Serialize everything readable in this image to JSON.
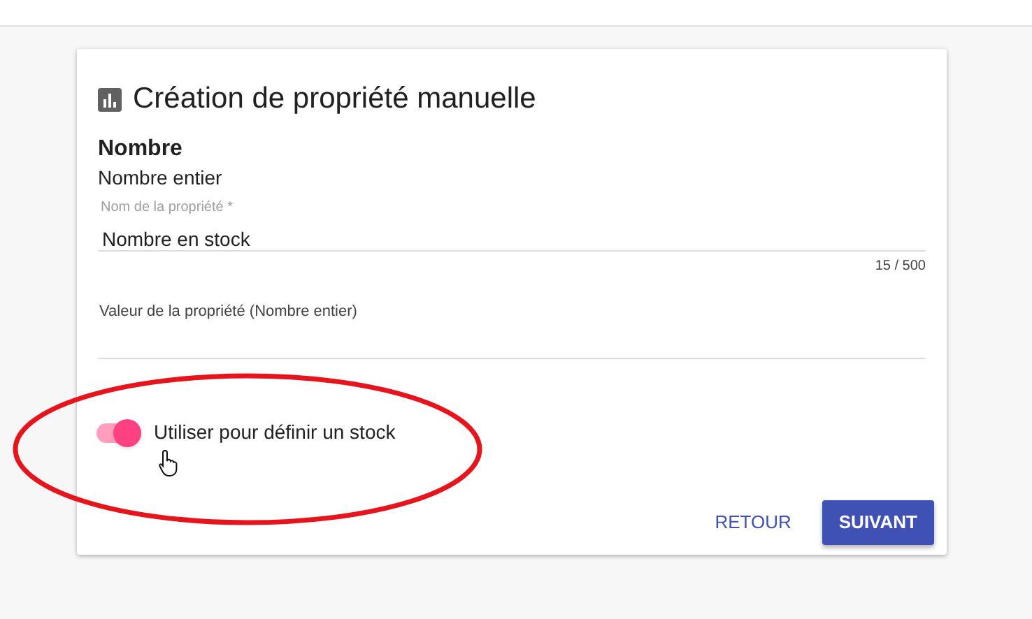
{
  "card": {
    "title": "Création de propriété manuelle",
    "type_name": "Nombre",
    "type_detail": "Nombre entier",
    "fields": [
      {
        "label": "Nom de la propriété *",
        "value": "Nombre en stock",
        "counter": "15 / 500"
      },
      {
        "label": "Valeur de la propriété (Nombre entier)"
      }
    ],
    "toggle": {
      "label": "Utiliser pour définir un stock",
      "on": true
    },
    "buttons": [
      {
        "label": "RETOUR",
        "kind": "text"
      },
      {
        "label": "SUIVANT",
        "kind": "raised"
      }
    ]
  }
}
